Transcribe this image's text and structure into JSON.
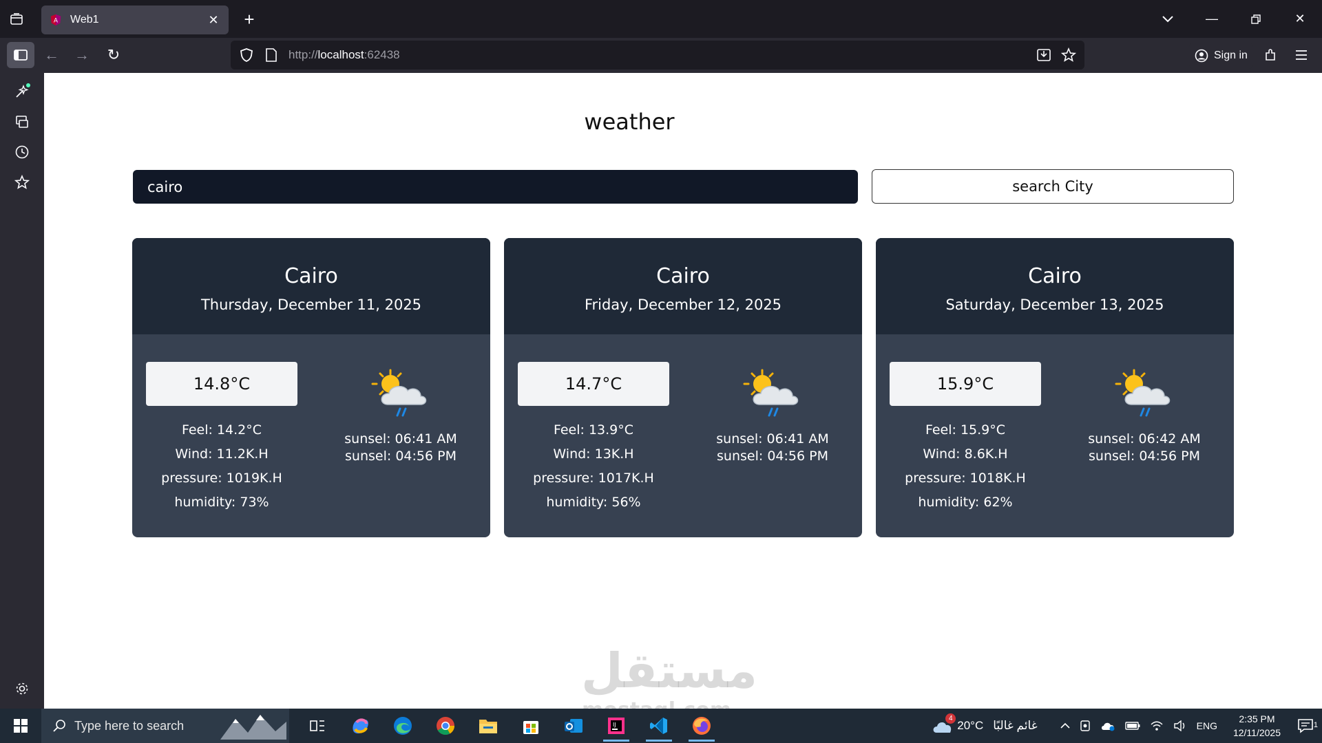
{
  "browser": {
    "tab_title": "Web1",
    "url_scheme": "http://",
    "url_host": "localhost",
    "url_port": ":62438",
    "sign_in_label": "Sign in"
  },
  "page": {
    "title": "weather",
    "search_value": "cairo",
    "search_button_label": "search City",
    "cards": [
      {
        "city": "Cairo",
        "date": "Thursday, December 11, 2025",
        "temp": "14.8°C",
        "feel": "Feel: 14.2°C",
        "wind": "Wind: 11.2K.H",
        "pressure": "pressure: 1019K.H",
        "humidity": "humidity: 73%",
        "sunrise": "sunsel: 06:41 AM",
        "sunset": "sunsel: 04:56 PM",
        "icon": "sun-cloud-rain-icon"
      },
      {
        "city": "Cairo",
        "date": "Friday, December 12, 2025",
        "temp": "14.7°C",
        "feel": "Feel: 13.9°C",
        "wind": "Wind: 13K.H",
        "pressure": "pressure: 1017K.H",
        "humidity": "humidity: 56%",
        "sunrise": "sunsel: 06:41 AM",
        "sunset": "sunsel: 04:56 PM",
        "icon": "sun-cloud-rain-icon"
      },
      {
        "city": "Cairo",
        "date": "Saturday, December 13, 2025",
        "temp": "15.9°C",
        "feel": "Feel: 15.9°C",
        "wind": "Wind: 8.6K.H",
        "pressure": "pressure: 1018K.H",
        "humidity": "humidity: 62%",
        "sunrise": "sunsel: 06:42 AM",
        "sunset": "sunsel: 04:56 PM",
        "icon": "sun-cloud-rain-icon"
      }
    ],
    "watermark": "مستقل",
    "watermark_sub": "mostaql.com"
  },
  "taskbar": {
    "search_placeholder": "Type here to search",
    "weather_temp": "20°C",
    "weather_text": "غائم غالبًا",
    "weather_badge": "4",
    "language": "ENG",
    "time": "2:35 PM",
    "date": "12/11/2025",
    "notification_count": "1"
  }
}
